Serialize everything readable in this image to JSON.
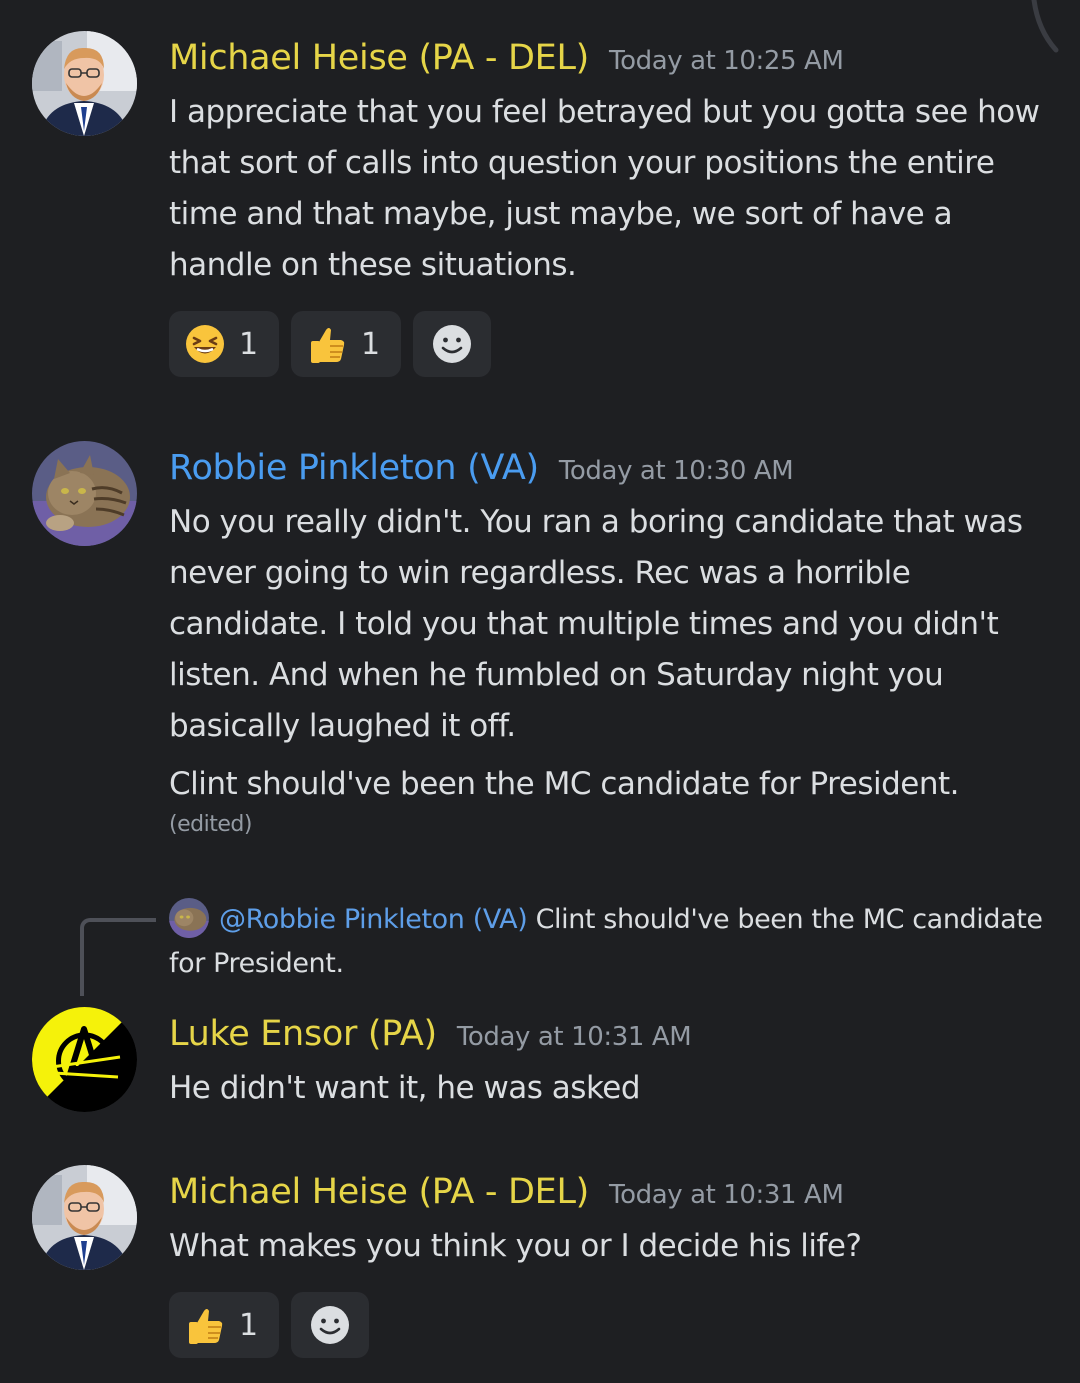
{
  "messages": [
    {
      "author": "Michael Heise (PA - DEL)",
      "author_color": "#e6d548",
      "timestamp": "Today at 10:25 AM",
      "avatar_icon": "profile-photo-man-suit",
      "text": "I appreciate that you feel betrayed but you gotta see how that sort of calls into question your positions the entire time and that maybe, just maybe, we sort of have a handle on these situations.",
      "reactions": [
        {
          "emoji": "laughing-face-icon",
          "count": "1"
        },
        {
          "emoji": "thumbs-up-icon",
          "count": "1"
        },
        {
          "emoji": "add-reaction-icon"
        }
      ]
    },
    {
      "author": "Robbie Pinkleton (VA)",
      "author_color": "#4a9cf0",
      "timestamp": "Today at 10:30 AM",
      "avatar_icon": "profile-photo-cat",
      "text": "No you really didn't. You ran a boring candidate that was never going to win regardless. Rec was a horrible candidate. I told you that multiple times and you didn't listen. And when he fumbled on Saturday night you basically laughed it off.",
      "text2": "Clint should've been the MC candidate for President.",
      "edited": "(edited)"
    },
    {
      "reply": {
        "mention": "@Robbie Pinkleton (VA)",
        "text": "Clint should've been the MC candidate for President."
      },
      "author": "Luke Ensor (PA)",
      "author_color": "#e6d548",
      "timestamp": "Today at 10:31 AM",
      "avatar_icon": "anarchy-symbol-logo",
      "text": "He didn't want it, he was asked"
    },
    {
      "author": "Michael Heise (PA - DEL)",
      "author_color": "#e6d548",
      "timestamp": "Today at 10:31 AM",
      "avatar_icon": "profile-photo-man-suit",
      "text": "What makes you think you or I decide his life?",
      "reactions": [
        {
          "emoji": "thumbs-up-icon",
          "count": "1"
        },
        {
          "emoji": "add-reaction-icon"
        }
      ]
    }
  ]
}
